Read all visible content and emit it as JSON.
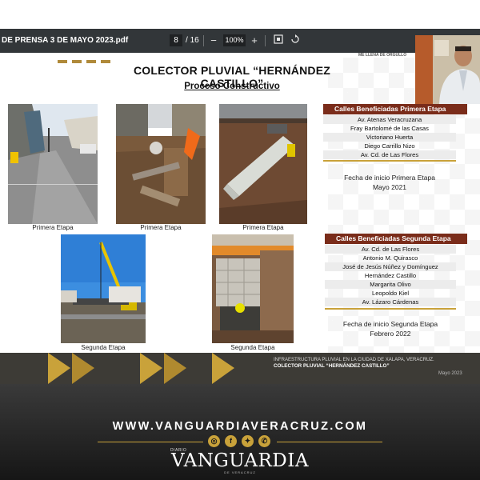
{
  "toolbar": {
    "file_name": "DE PRENSA 3 DE MAYO 2023.pdf",
    "current_page": "8",
    "page_separator": "/",
    "total_pages": "16",
    "zoom_out_symbol": "−",
    "zoom_level": "100%",
    "zoom_in_symbol": "+",
    "fit_icon": "fit-page-icon",
    "rotate_icon": "rotate-icon"
  },
  "slide": {
    "motto": "ME LLENA DE ORGULLO",
    "title": "COLECTOR PLUVIAL “HERNÁNDEZ CASTILLO”",
    "subtitle": "Proceso Constructivo",
    "photos": [
      {
        "caption": "Primera Etapa"
      },
      {
        "caption": "Primera Etapa"
      },
      {
        "caption": "Primera Etapa"
      },
      {
        "caption": "Segunda Etapa"
      },
      {
        "caption": "Segunda Etapa"
      }
    ],
    "first_stage": {
      "header": "Calles  Beneficiadas Primera Etapa",
      "streets": [
        "Av. Atenas Veracruzana",
        "Fray Bartolomé de las Casas",
        "Victoriano Huerta",
        "Diego Carrillo Nizo",
        "Av. Cd. de Las Flores"
      ],
      "start_label": "Fecha de inicio Primera Etapa",
      "start_date": "Mayo 2021"
    },
    "second_stage": {
      "header": "Calles  Beneficiadas Segunda Etapa",
      "streets": [
        "Av. Cd. de Las Flores",
        "Antonio M. Quirasco",
        "José de Jesús Núñez  y Domínguez",
        "Hernández Castillo",
        "Margarita Olivo",
        "Leopoldo Kiel",
        "Av. Lázaro Cárdenas"
      ],
      "start_label": "Fecha de inicio Segunda Etapa",
      "start_date": "Febrero 2022"
    },
    "footer": {
      "line1": "INFRAESTRUCTURA PLUVIAL EN LA CIUDAD DE XALAPA, VERACRUZ.",
      "line2": "COLECTOR PLUVIAL “HERNÁNDEZ CASTILLO”",
      "date": "Mayo 2023"
    }
  },
  "brand": {
    "url": "WWW.VANGUARDIAVERACRUZ.COM",
    "social": [
      "instagram-icon",
      "facebook-icon",
      "twitter-icon",
      "whatsapp-icon"
    ],
    "diario": "DIARIO",
    "masthead": "VANGUARDIA",
    "sub": "DE VERACRUZ"
  },
  "colors": {
    "toolbar": "#323639",
    "header_brown": "#7a2c1a",
    "gold": "#c9a23a",
    "footer_band": "#3d3b36"
  }
}
